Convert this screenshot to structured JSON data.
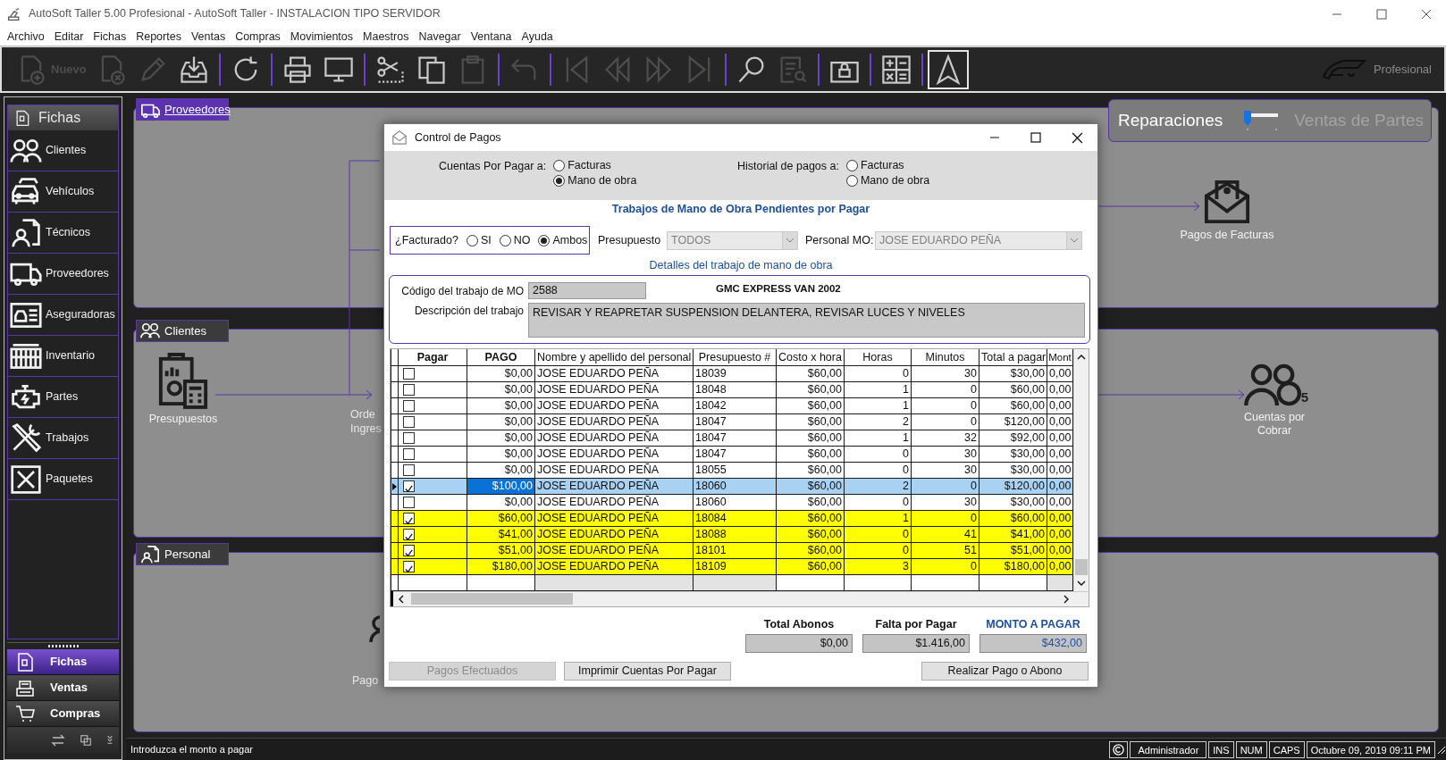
{
  "window": {
    "title": "AutoSoft Taller 5.00 Profesional - AutoSoft Taller - INSTALACION TIPO SERVIDOR"
  },
  "menu": [
    "Archivo",
    "Editar",
    "Fichas",
    "Reportes",
    "Ventas",
    "Compras",
    "Movimientos",
    "Maestros",
    "Navegar",
    "Ventana",
    "Ayuda"
  ],
  "toolbar": {
    "groups": [
      [
        {
          "label": "Nuevo",
          "disabled": true,
          "selected": false
        },
        {
          "disabled": true,
          "selected": false
        },
        {
          "disabled": true,
          "selected": false
        },
        {
          "disabled": false,
          "selected": false
        }
      ],
      [
        {
          "disabled": false,
          "selected": false
        }
      ],
      [
        {
          "disabled": false,
          "selected": false
        },
        {
          "disabled": false,
          "selected": false
        }
      ],
      [
        {
          "disabled": false,
          "selected": false
        },
        {
          "disabled": false,
          "selected": false
        },
        {
          "disabled": true,
          "selected": false
        }
      ],
      [
        {
          "disabled": true,
          "selected": false
        }
      ],
      [
        {
          "disabled": true,
          "selected": false
        },
        {
          "disabled": true,
          "selected": false
        },
        {
          "disabled": true,
          "selected": false
        },
        {
          "disabled": true,
          "selected": false
        }
      ],
      [
        {
          "disabled": false,
          "selected": false
        },
        {
          "disabled": true,
          "selected": false
        }
      ],
      [
        {
          "disabled": false,
          "selected": false
        }
      ],
      [
        {
          "disabled": false,
          "selected": false
        }
      ],
      [
        {
          "disabled": false,
          "selected": true
        }
      ]
    ],
    "logo_text": "Profesional"
  },
  "sidebar": {
    "header": "Fichas",
    "items": [
      {
        "label": "Clientes"
      },
      {
        "label": "Vehículos"
      },
      {
        "label": "Técnicos"
      },
      {
        "label": "Proveedores"
      },
      {
        "label": "Aseguradoras"
      },
      {
        "label": "Inventario"
      },
      {
        "label": "Partes"
      },
      {
        "label": "Trabajos"
      },
      {
        "label": "Paquetes"
      }
    ],
    "sections": [
      {
        "label": "Fichas",
        "selected": true
      },
      {
        "label": "Ventas",
        "selected": false
      },
      {
        "label": "Compras",
        "selected": false
      }
    ]
  },
  "main": {
    "mode_switch": {
      "options": [
        {
          "label": "Reparaciones",
          "selected": true
        },
        {
          "label": "Ventas de Partes",
          "selected": false
        }
      ]
    },
    "panels": [
      {
        "title": "Proveedores",
        "selected": true,
        "nodes": [
          {
            "lines": [
              "Pagos de Facturas"
            ]
          }
        ]
      },
      {
        "title": "Clientes",
        "selected": false,
        "nodes": [
          {
            "lines": [
              "Presupuestos"
            ]
          },
          {
            "lines": [
              "Orde",
              "Ingres"
            ]
          },
          {
            "lines": [
              "Cuentas por",
              "Cobrar"
            ],
            "badge": "5"
          }
        ]
      },
      {
        "title": "Personal",
        "selected": false,
        "nodes": [
          {
            "lines": [
              "Pago"
            ]
          }
        ]
      }
    ]
  },
  "dialog": {
    "title": "Control de Pagos",
    "payables": {
      "label": "Cuentas Por Pagar a:",
      "options": [
        {
          "label": "Facturas",
          "selected": false
        },
        {
          "label": "Mano de obra",
          "selected": true
        }
      ]
    },
    "history": {
      "label": "Historial de pagos a:",
      "options": [
        {
          "label": "Facturas",
          "selected": false
        },
        {
          "label": "Mano de obra",
          "selected": false
        }
      ]
    },
    "heading": "Trabajos de Mano de Obra Pendientes por Pagar",
    "invoiced": {
      "label": "¿Facturado?",
      "options": [
        {
          "label": "SI",
          "selected": false
        },
        {
          "label": "NO",
          "selected": false
        },
        {
          "label": "Ambos",
          "selected": true
        }
      ]
    },
    "budget": {
      "label": "Presupuesto",
      "value": "TODOS"
    },
    "staff": {
      "label": "Personal MO:",
      "value": "JOSE EDUARDO PEÑA"
    },
    "details_heading": "Detalles del trabajo de mano de obra",
    "code": {
      "label": "Código del trabajo de MO",
      "value": "2588"
    },
    "vehicle": "GMC EXPRESS VAN 2002",
    "description": {
      "label": "Descripción del trabajo",
      "value": "REVISAR Y REAPRETAR SUSPENSION DELANTERA, REVISAR LUCES Y NIVELES"
    },
    "table": {
      "columns": [
        {
          "label": "Pagar",
          "bold": true
        },
        {
          "label": "PAGO",
          "bold": true
        },
        {
          "label": "Nombre y apellido del personal",
          "bold": false
        },
        {
          "label": "Presupuesto #",
          "bold": false
        },
        {
          "label": "Costo x hora",
          "bold": false
        },
        {
          "label": "Horas",
          "bold": false
        },
        {
          "label": "Minutos",
          "bold": false
        },
        {
          "label": "Total a pagar",
          "bold": false
        },
        {
          "label": "Mont",
          "bold": false
        }
      ],
      "rows": [
        {
          "checked": false,
          "selected": false,
          "highlighted": false,
          "cells": [
            "",
            "$0,00",
            "JOSE EDUARDO PEÑA",
            "18039",
            "$60,00",
            "0",
            "30",
            "$30,00",
            "0,00"
          ]
        },
        {
          "checked": false,
          "selected": false,
          "highlighted": false,
          "cells": [
            "",
            "$0,00",
            "JOSE EDUARDO PEÑA",
            "18048",
            "$60,00",
            "1",
            "0",
            "$60,00",
            "0,00"
          ]
        },
        {
          "checked": false,
          "selected": false,
          "highlighted": false,
          "cells": [
            "",
            "$0,00",
            "JOSE EDUARDO PEÑA",
            "18042",
            "$60,00",
            "1",
            "0",
            "$60,00",
            "0,00"
          ]
        },
        {
          "checked": false,
          "selected": false,
          "highlighted": false,
          "cells": [
            "",
            "$0,00",
            "JOSE EDUARDO PEÑA",
            "18047",
            "$60,00",
            "2",
            "0",
            "$120,00",
            "0,00"
          ]
        },
        {
          "checked": false,
          "selected": false,
          "highlighted": false,
          "cells": [
            "",
            "$0,00",
            "JOSE EDUARDO PEÑA",
            "18047",
            "$60,00",
            "1",
            "32",
            "$92,00",
            "0,00"
          ]
        },
        {
          "checked": false,
          "selected": false,
          "highlighted": false,
          "cells": [
            "",
            "$0,00",
            "JOSE EDUARDO PEÑA",
            "18047",
            "$60,00",
            "0",
            "30",
            "$30,00",
            "0,00"
          ]
        },
        {
          "checked": false,
          "selected": false,
          "highlighted": false,
          "cells": [
            "",
            "$0,00",
            "JOSE EDUARDO PEÑA",
            "18055",
            "$60,00",
            "0",
            "30",
            "$30,00",
            "0,00"
          ]
        },
        {
          "checked": true,
          "selected": true,
          "highlighted": false,
          "cells": [
            "",
            "$100,00",
            "JOSE EDUARDO PEÑA",
            "18060",
            "$60,00",
            "2",
            "0",
            "$120,00",
            "0,00"
          ]
        },
        {
          "checked": false,
          "selected": false,
          "highlighted": false,
          "cells": [
            "",
            "$0,00",
            "JOSE EDUARDO PEÑA",
            "18060",
            "$60,00",
            "0",
            "30",
            "$30,00",
            "0,00"
          ]
        },
        {
          "checked": true,
          "selected": false,
          "highlighted": true,
          "cells": [
            "",
            "$60,00",
            "JOSE EDUARDO PEÑA",
            "18084",
            "$60,00",
            "1",
            "0",
            "$60,00",
            "0,00"
          ]
        },
        {
          "checked": true,
          "selected": false,
          "highlighted": true,
          "cells": [
            "",
            "$41,00",
            "JOSE EDUARDO PEÑA",
            "18088",
            "$60,00",
            "0",
            "41",
            "$41,00",
            "0,00"
          ]
        },
        {
          "checked": true,
          "selected": false,
          "highlighted": true,
          "cells": [
            "",
            "$51,00",
            "JOSE EDUARDO PEÑA",
            "18101",
            "$60,00",
            "0",
            "51",
            "$51,00",
            "0,00"
          ]
        },
        {
          "checked": true,
          "selected": false,
          "highlighted": true,
          "cells": [
            "",
            "$180,00",
            "JOSE EDUARDO PEÑA",
            "18109",
            "$60,00",
            "3",
            "0",
            "$180,00",
            "0,00"
          ]
        }
      ]
    },
    "totals": [
      {
        "label": "Total Abonos",
        "value": "$0,00",
        "emphasis": false
      },
      {
        "label": "Falta por Pagar",
        "value": "$1.416,00",
        "emphasis": false
      },
      {
        "label": "MONTO A PAGAR",
        "value": "$432,00",
        "emphasis": true
      }
    ],
    "buttons": [
      {
        "label": "Pagos Efectuados",
        "disabled": true
      },
      {
        "label": "Imprimir Cuentas Por Pagar",
        "disabled": false
      },
      {
        "label": "Realizar Pago o Abono",
        "disabled": false
      }
    ]
  },
  "status_bar": {
    "message": "Introduzca el monto a pagar",
    "user": "Administrador",
    "indicators": [
      "INS",
      "NUM",
      "CAPS"
    ],
    "datetime": "Octubre 09, 2019 09:11 PM"
  }
}
